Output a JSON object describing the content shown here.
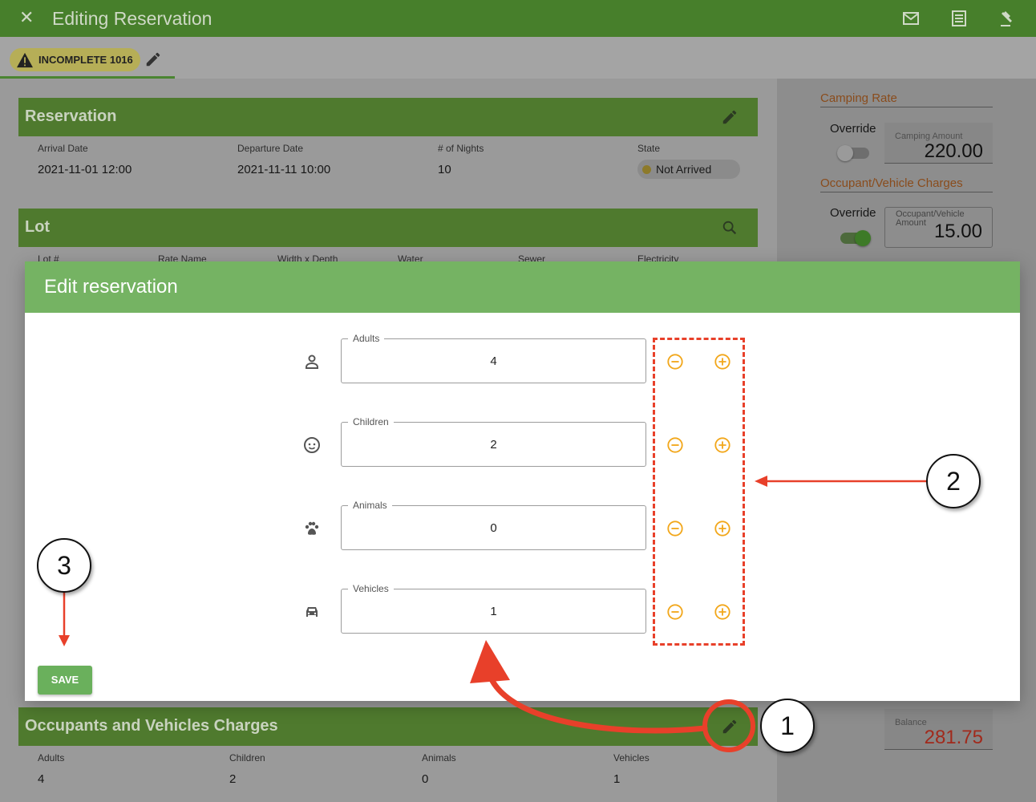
{
  "appbar": {
    "title": "Editing Reservation",
    "icons": [
      "close-icon",
      "mail-icon",
      "receipt-icon",
      "gavel-icon"
    ]
  },
  "status_chip": {
    "label": "INCOMPLETE 1016"
  },
  "reservation": {
    "title": "Reservation",
    "arrival_label": "Arrival Date",
    "arrival": "2021-11-01 12:00",
    "departure_label": "Departure Date",
    "departure": "2021-11-11 10:00",
    "nights_label": "# of Nights",
    "nights": "10",
    "state_label": "State",
    "state": "Not Arrived"
  },
  "lot": {
    "title": "Lot",
    "columns": [
      "Lot #",
      "Rate Name",
      "Width x Depth",
      "Water",
      "Sewer",
      "Electricity"
    ]
  },
  "side": {
    "camping_rate": "Camping Rate",
    "override1": "Override",
    "camping_amount_label": "Camping Amount",
    "camping_amount": "220.00",
    "occupant_charges": "Occupant/Vehicle Charges",
    "override2": "Override",
    "occupant_amount_label_1": "Occupant/Vehicle",
    "occupant_amount_label_2": "Amount",
    "occupant_amount": "15.00",
    "balance_label": "Balance",
    "balance": "281.75",
    "balance_color": "#a12a1c"
  },
  "occupants_card": {
    "title": "Occupants and Vehicles Charges",
    "adults_label": "Adults",
    "adults": "4",
    "children_label": "Children",
    "children": "2",
    "animals_label": "Animals",
    "animals": "0",
    "vehicles_label": "Vehicles",
    "vehicles": "1"
  },
  "modal": {
    "title": "Edit reservation",
    "fields": [
      {
        "label": "Adults",
        "value": "4",
        "icon": "person-icon"
      },
      {
        "label": "Children",
        "value": "2",
        "icon": "child-face-icon"
      },
      {
        "label": "Animals",
        "value": "0",
        "icon": "paw-icon"
      },
      {
        "label": "Vehicles",
        "value": "1",
        "icon": "car-icon"
      }
    ],
    "save_label": "SAVE"
  },
  "annotations": {
    "one": "1",
    "two": "2",
    "three": "3"
  },
  "colors": {
    "appbar": "#477f2b",
    "modal_header": "#75b363",
    "accent_orange": "#f2a71b",
    "annotation_red": "#e8402a"
  }
}
